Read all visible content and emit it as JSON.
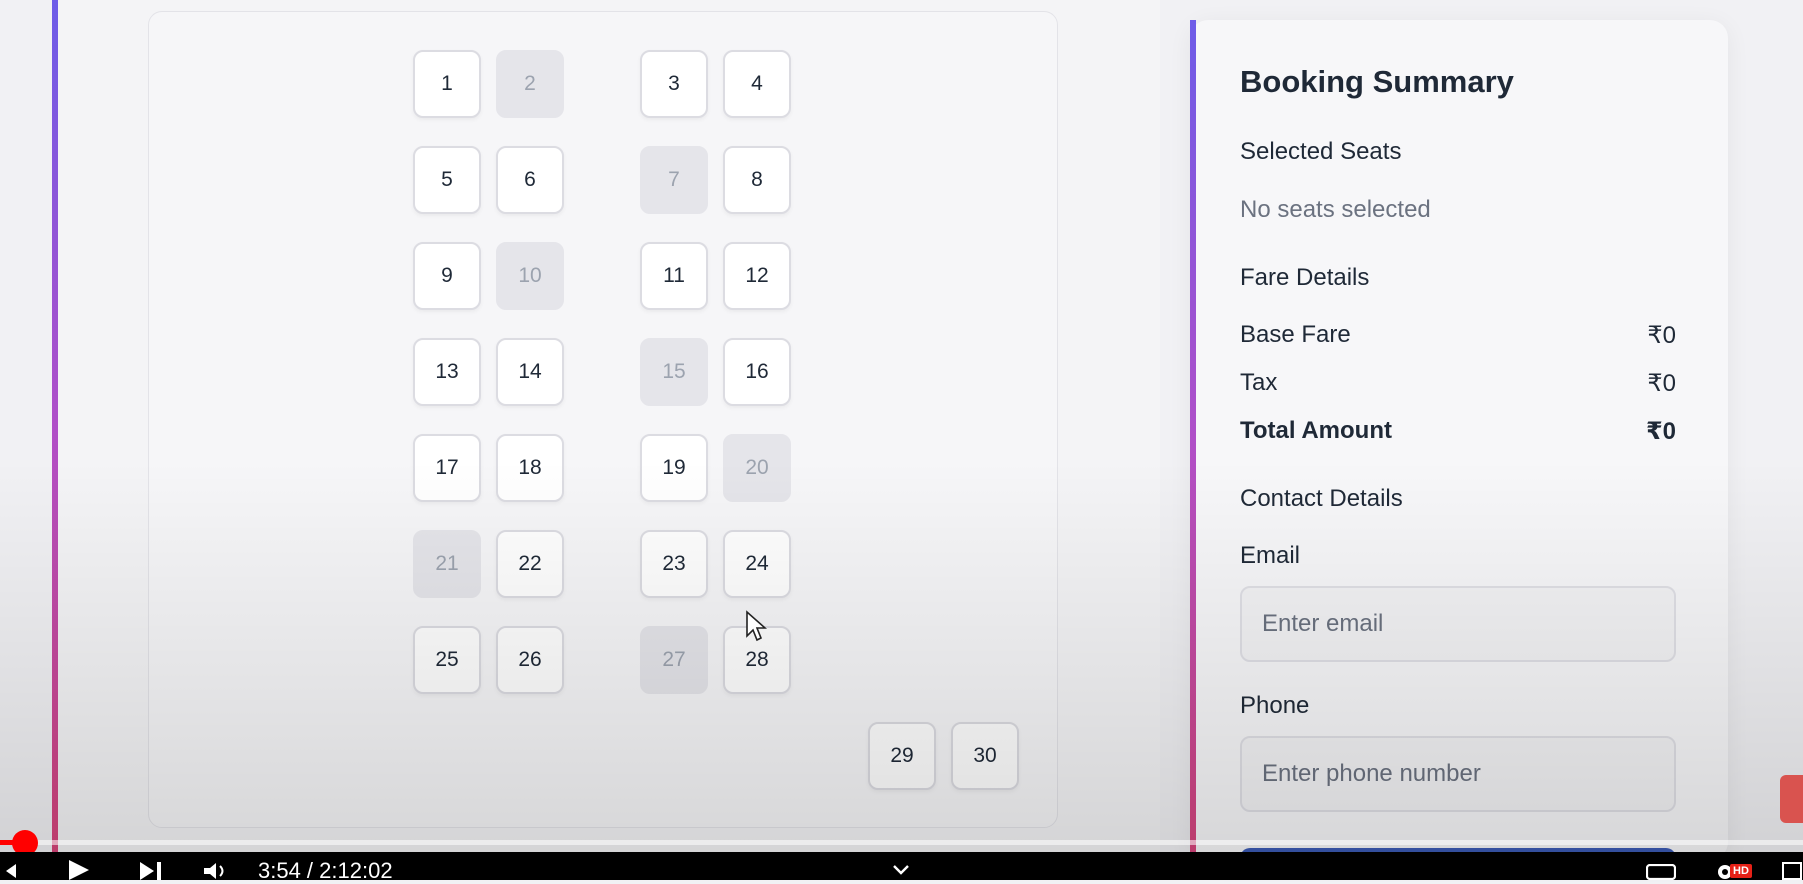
{
  "seats": [
    {
      "label": "1",
      "state": "available"
    },
    {
      "label": "2",
      "state": "booked"
    },
    {
      "label": "3",
      "state": "available"
    },
    {
      "label": "4",
      "state": "available"
    },
    {
      "label": "5",
      "state": "available"
    },
    {
      "label": "6",
      "state": "available"
    },
    {
      "label": "7",
      "state": "booked"
    },
    {
      "label": "8",
      "state": "available"
    },
    {
      "label": "9",
      "state": "available"
    },
    {
      "label": "10",
      "state": "booked"
    },
    {
      "label": "11",
      "state": "available"
    },
    {
      "label": "12",
      "state": "available"
    },
    {
      "label": "13",
      "state": "available"
    },
    {
      "label": "14",
      "state": "available"
    },
    {
      "label": "15",
      "state": "booked"
    },
    {
      "label": "16",
      "state": "available"
    },
    {
      "label": "17",
      "state": "available"
    },
    {
      "label": "18",
      "state": "available"
    },
    {
      "label": "19",
      "state": "available"
    },
    {
      "label": "20",
      "state": "booked"
    },
    {
      "label": "21",
      "state": "booked"
    },
    {
      "label": "22",
      "state": "available"
    },
    {
      "label": "23",
      "state": "available"
    },
    {
      "label": "24",
      "state": "available"
    },
    {
      "label": "25",
      "state": "available"
    },
    {
      "label": "26",
      "state": "available"
    },
    {
      "label": "27",
      "state": "booked"
    },
    {
      "label": "28",
      "state": "available"
    },
    {
      "label": "29",
      "state": "available"
    },
    {
      "label": "30",
      "state": "available"
    }
  ],
  "summary": {
    "title": "Booking Summary",
    "selected_seats_heading": "Selected Seats",
    "selected_seats_text": "No seats selected",
    "fare_heading": "Fare Details",
    "base_fare_label": "Base Fare",
    "base_fare_value": "₹0",
    "tax_label": "Tax",
    "tax_value": "₹0",
    "total_label": "Total Amount",
    "total_value": "₹0",
    "contact_heading": "Contact Details",
    "email_label": "Email",
    "email_placeholder": "Enter email",
    "phone_label": "Phone",
    "phone_placeholder": "Enter phone number"
  },
  "player": {
    "time": "3:54 / 2:12:02",
    "progress_fraction": 0.003,
    "quality_badge": "HD"
  },
  "colors": {
    "accent_start": "#6d5ce8",
    "accent_mid": "#b04fc8",
    "accent_end": "#d8457a",
    "booked_seat": "#e5e5ea",
    "progress": "#ff0000"
  }
}
